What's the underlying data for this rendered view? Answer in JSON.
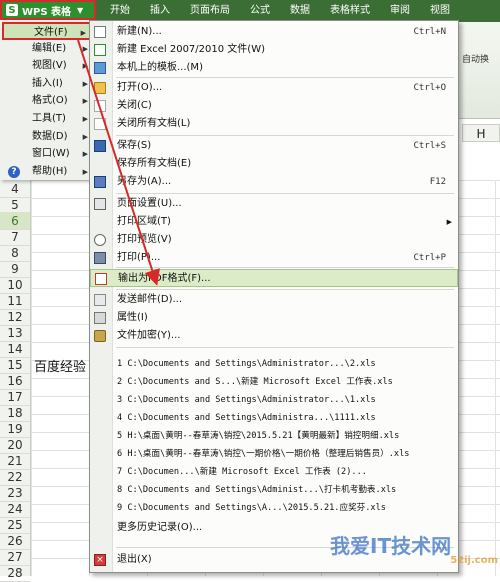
{
  "app": {
    "button_label": "WPS 表格"
  },
  "ribbon": {
    "tabs": [
      "开始",
      "插入",
      "页面布局",
      "公式",
      "数据",
      "表格样式",
      "审阅",
      "视图"
    ],
    "right_button": "自动换"
  },
  "sheet": {
    "column_header": "H",
    "rows": [
      "4",
      "5",
      "6",
      "7",
      "8",
      "9",
      "10",
      "11",
      "12",
      "13",
      "14",
      "15",
      "16",
      "17",
      "18",
      "19",
      "20",
      "21",
      "22",
      "23",
      "24",
      "25",
      "26",
      "27",
      "28"
    ],
    "selected_row": "6",
    "cell_row15": "百度经验"
  },
  "left_menu": [
    {
      "label": "文件(F)",
      "has_submenu": true,
      "active": true
    },
    {
      "label": "编辑(E)",
      "has_submenu": true
    },
    {
      "label": "视图(V)",
      "has_submenu": true
    },
    {
      "label": "插入(I)",
      "has_submenu": true
    },
    {
      "label": "格式(O)",
      "has_submenu": true
    },
    {
      "label": "工具(T)",
      "has_submenu": true
    },
    {
      "label": "数据(D)",
      "has_submenu": true
    },
    {
      "label": "窗口(W)",
      "has_submenu": true
    },
    {
      "label": "帮助(H)",
      "has_submenu": true,
      "icon": "help-icon"
    }
  ],
  "file_menu": {
    "items": [
      {
        "label": "新建(N)...",
        "shortcut": "Ctrl+N",
        "icon": "new-doc-icon"
      },
      {
        "label": "新建 Excel 2007/2010 文件(W)",
        "shortcut": "",
        "icon": "new-excel-icon"
      },
      {
        "label": "本机上的模板...(M)",
        "shortcut": "",
        "icon": "template-icon"
      },
      {
        "label": "打开(O)...",
        "shortcut": "Ctrl+O",
        "icon": "open-folder-icon"
      },
      {
        "label": "关闭(C)",
        "shortcut": "",
        "icon": "close-doc-icon"
      },
      {
        "label": "关闭所有文档(L)",
        "shortcut": "",
        "icon": "close-all-icon"
      },
      {
        "label": "保存(S)",
        "shortcut": "Ctrl+S",
        "icon": "save-icon"
      },
      {
        "label": "保存所有文档(E)",
        "shortcut": "",
        "icon": ""
      },
      {
        "label": "另存为(A)...",
        "shortcut": "F12",
        "icon": "save-as-icon"
      },
      {
        "label": "页面设置(U)...",
        "shortcut": "",
        "icon": "page-setup-icon"
      },
      {
        "label": "打印区域(T)",
        "shortcut": "",
        "icon": "",
        "has_submenu": true
      },
      {
        "label": "打印预览(V)",
        "shortcut": "",
        "icon": "print-preview-icon"
      },
      {
        "label": "打印(P)...",
        "shortcut": "Ctrl+P",
        "icon": "print-icon"
      },
      {
        "label": "输出为PDF格式(F)...",
        "shortcut": "",
        "icon": "pdf-icon",
        "highlighted": true
      },
      {
        "label": "发送邮件(D)...",
        "shortcut": "",
        "icon": "mail-icon"
      },
      {
        "label": "属性(I)",
        "shortcut": "",
        "icon": "properties-icon"
      },
      {
        "label": "文件加密(Y)...",
        "shortcut": "",
        "icon": "encrypt-icon"
      }
    ],
    "recent_files": [
      "1 C:\\Documents and Settings\\Administrator...\\2.xls",
      "2 C:\\Documents and S...\\新建 Microsoft Excel 工作表.xls",
      "3 C:\\Documents and Settings\\Administrator...\\1.xls",
      "4 C:\\Documents and Settings\\Administra...\\1111.xls",
      "5 H:\\桌面\\黄明--春草涛\\销控\\2015.5.21【黄明最新】销控明细.xls",
      "6 H:\\桌面\\黄明--春草涛\\销控\\一期价格\\一期价格（整理后销售员）.xls",
      "7 C:\\Documen...\\新建 Microsoft Excel 工作表 (2)...",
      "8 C:\\Documents and Settings\\Administ...\\打卡机考勤表.xls",
      "9 C:\\Documents and Settings\\A...\\2015.5.21.应奖芬.xls"
    ],
    "more_history": "更多历史记录(O)...",
    "exit": "退出(X)"
  },
  "watermark": {
    "text": "我爱IT技术网",
    "site": "52ij.com"
  },
  "colors": {
    "ribbon_green": "#3b6e35",
    "highlight_red": "#d62a2a",
    "menu_highlight": "#dcebc8"
  }
}
